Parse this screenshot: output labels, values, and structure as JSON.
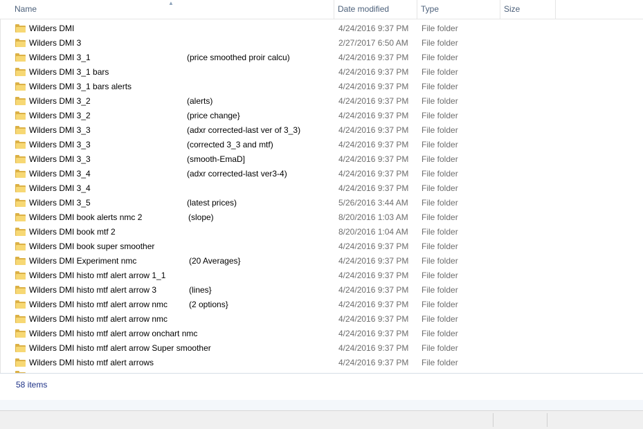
{
  "columns": {
    "name": "Name",
    "date_modified": "Date modified",
    "type": "Type",
    "size": "Size"
  },
  "icons": {
    "folder": "folder-icon",
    "sort": "sort-up-icon"
  },
  "colors": {
    "folder_dark": "#dcb146",
    "folder_light": "#f7d874",
    "header_text": "#4c607a",
    "status_text": "#1e3287",
    "meta_text": "#6d6d6d"
  },
  "rows": [
    {
      "name": "Wilders DMI",
      "note": "",
      "date": "4/24/2016 9:37 PM",
      "type": "File folder"
    },
    {
      "name": "Wilders DMI 3",
      "note": "",
      "date": "2/27/2017 6:50 AM",
      "type": "File folder"
    },
    {
      "name": "Wilders DMI 3_1",
      "note": "(price smoothed proir calcu)",
      "date": "4/24/2016 9:37 PM",
      "type": "File folder"
    },
    {
      "name": "Wilders DMI 3_1 bars",
      "note": "",
      "date": "4/24/2016 9:37 PM",
      "type": "File folder"
    },
    {
      "name": "Wilders DMI 3_1 bars alerts",
      "note": "",
      "date": "4/24/2016 9:37 PM",
      "type": "File folder"
    },
    {
      "name": "Wilders DMI 3_2",
      "note": "(alerts)",
      "date": "4/24/2016 9:37 PM",
      "type": "File folder"
    },
    {
      "name": "Wilders DMI 3_2",
      "note": "(price change}",
      "date": "4/24/2016 9:37 PM",
      "type": "File folder"
    },
    {
      "name": "Wilders DMI 3_3",
      "note": "(adxr corrected-last ver of 3_3)",
      "date": "4/24/2016 9:37 PM",
      "type": "File folder"
    },
    {
      "name": "Wilders DMI 3_3",
      "note": "(corrected 3_3 and mtf)",
      "date": "4/24/2016 9:37 PM",
      "type": "File folder"
    },
    {
      "name": "Wilders DMI 3_3",
      "note": "(smooth-EmaD]",
      "date": "4/24/2016 9:37 PM",
      "type": "File folder"
    },
    {
      "name": "Wilders DMI 3_4",
      "note": "(adxr corrected-last ver3-4)",
      "date": "4/24/2016 9:37 PM",
      "type": "File folder"
    },
    {
      "name": "Wilders DMI 3_4",
      "note": "",
      "date": "4/24/2016 9:37 PM",
      "type": "File folder"
    },
    {
      "name": "Wilders DMI 3_5",
      "note": "(latest prices)",
      "date": "5/26/2016 3:44 AM",
      "type": "File folder"
    },
    {
      "name": "Wilders DMI book alerts nmc 2",
      "note": "(slope)",
      "date": "8/20/2016 1:03 AM",
      "type": "File folder"
    },
    {
      "name": "Wilders DMI book mtf 2",
      "note": "",
      "date": "8/20/2016 1:04 AM",
      "type": "File folder"
    },
    {
      "name": "Wilders DMI book super smoother",
      "note": "",
      "date": "4/24/2016 9:37 PM",
      "type": "File folder"
    },
    {
      "name": "Wilders DMI Experiment nmc",
      "note": "(20 Averages}",
      "date": "4/24/2016 9:37 PM",
      "type": "File folder"
    },
    {
      "name": "Wilders DMI histo mtf alert arrow 1_1",
      "note": "",
      "date": "4/24/2016 9:37 PM",
      "type": "File folder"
    },
    {
      "name": "Wilders DMI histo mtf alert arrow 3",
      "note": "(lines}",
      "date": "4/24/2016 9:37 PM",
      "type": "File folder"
    },
    {
      "name": "Wilders DMI histo mtf alert arrow nmc",
      "note": "(2 options}",
      "date": "4/24/2016 9:37 PM",
      "type": "File folder"
    },
    {
      "name": "Wilders DMI histo mtf alert arrow nmc",
      "note": "",
      "date": "4/24/2016 9:37 PM",
      "type": "File folder"
    },
    {
      "name": "Wilders DMI histo mtf alert arrow onchart nmc",
      "note": "",
      "date": "4/24/2016 9:37 PM",
      "type": "File folder"
    },
    {
      "name": "Wilders DMI histo mtf alert arrow Super smoother",
      "note": "",
      "date": "4/24/2016 9:37 PM",
      "type": "File folder"
    },
    {
      "name": "Wilders DMI histo mtf alert arrows",
      "note": "",
      "date": "4/24/2016 9:37 PM",
      "type": "File folder"
    }
  ],
  "status": {
    "item_count": "58 items"
  }
}
